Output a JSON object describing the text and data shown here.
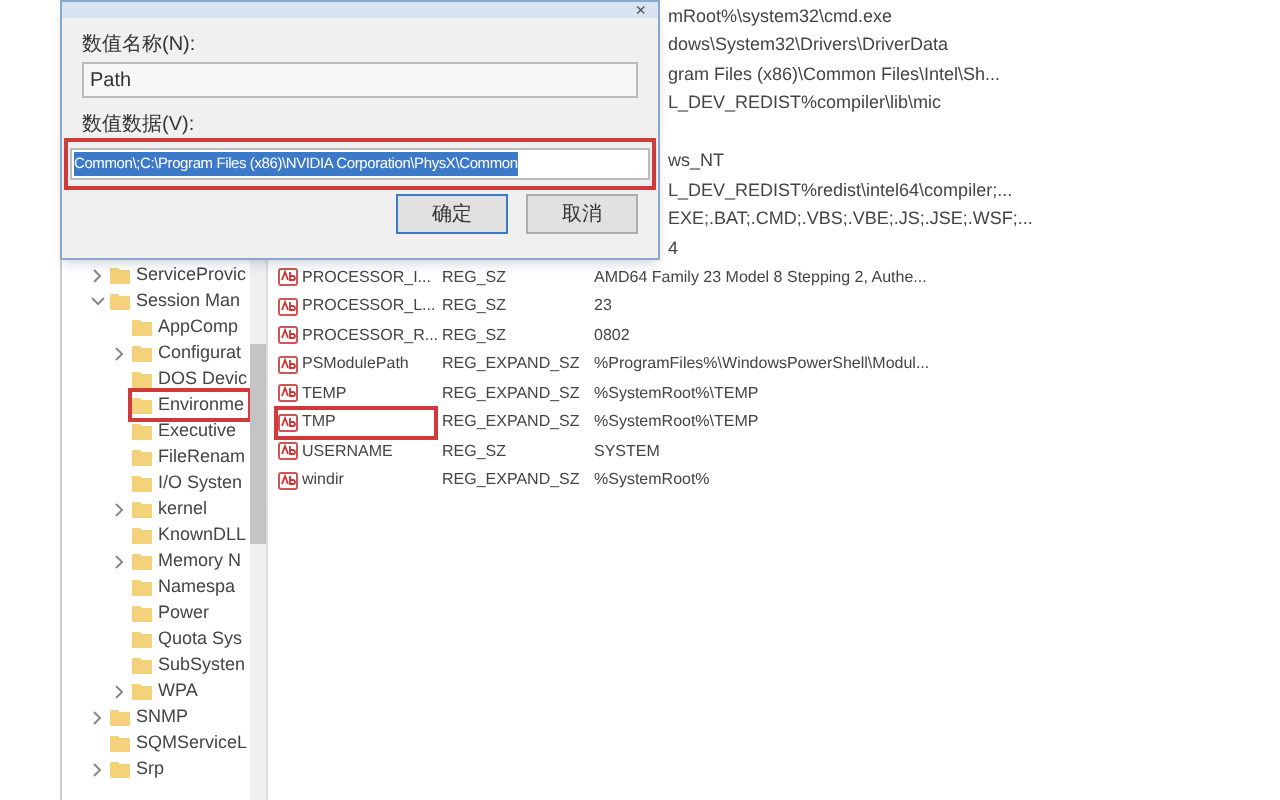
{
  "dialog": {
    "close": "×",
    "name_label": "数值名称(N):",
    "name_value": "Path",
    "data_label": "数值数据(V):",
    "data_value": "Common\\;C:\\Program Files (x86)\\NVIDIA Corporation\\PhysX\\Common",
    "data_highlighted": true,
    "buttons": [
      {
        "label": "确定",
        "default": true
      },
      {
        "label": "取消",
        "default": false
      }
    ]
  },
  "tree": [
    {
      "label": "ServiceProvic",
      "has_children": true,
      "expanded": false,
      "highlighted": false
    },
    {
      "label": "Session Man",
      "has_children": true,
      "expanded": true,
      "highlighted": false,
      "children": [
        {
          "label": "AppComp",
          "has_children": false,
          "expanded": false,
          "highlighted": false
        },
        {
          "label": "Configurat",
          "has_children": true,
          "expanded": false,
          "highlighted": false
        },
        {
          "label": "DOS Devic",
          "has_children": false,
          "expanded": false,
          "highlighted": false
        },
        {
          "label": "Environme",
          "has_children": false,
          "expanded": false,
          "highlighted": true
        },
        {
          "label": "Executive",
          "has_children": false,
          "expanded": false,
          "highlighted": false
        },
        {
          "label": "FileRenam",
          "has_children": false,
          "expanded": false,
          "highlighted": false
        },
        {
          "label": "I/O Systen",
          "has_children": false,
          "expanded": false,
          "highlighted": false
        },
        {
          "label": "kernel",
          "has_children": true,
          "expanded": false,
          "highlighted": false
        },
        {
          "label": "KnownDLL",
          "has_children": false,
          "expanded": false,
          "highlighted": false
        },
        {
          "label": "Memory N",
          "has_children": true,
          "expanded": false,
          "highlighted": false
        },
        {
          "label": "Namespa",
          "has_children": false,
          "expanded": false,
          "highlighted": false
        },
        {
          "label": "Power",
          "has_children": false,
          "expanded": false,
          "highlighted": false
        },
        {
          "label": "Quota Sys",
          "has_children": false,
          "expanded": false,
          "highlighted": false
        },
        {
          "label": "SubSysten",
          "has_children": false,
          "expanded": false,
          "highlighted": false
        },
        {
          "label": "WPA",
          "has_children": true,
          "expanded": false,
          "highlighted": false
        }
      ]
    },
    {
      "label": "SNMP",
      "has_children": true,
      "expanded": false,
      "highlighted": false
    },
    {
      "label": "SQMServiceL",
      "has_children": false,
      "expanded": false,
      "highlighted": false
    },
    {
      "label": "Srp",
      "has_children": true,
      "expanded": false,
      "highlighted": false
    }
  ],
  "hidden_rows": [
    "mRoot%\\system32\\cmd.exe",
    "dows\\System32\\Drivers\\DriverData",
    "gram Files (x86)\\Common Files\\Intel\\Sh...",
    "L_DEV_REDIST%compiler\\lib\\mic",
    null,
    "ws_NT",
    "L_DEV_REDIST%redist\\intel64\\compiler;...",
    "EXE;.BAT;.CMD;.VBS;.VBE;.JS;.JSE;.WSF;...",
    "4"
  ],
  "values": [
    {
      "name": "PROCESSOR_I...",
      "type": "REG_SZ",
      "data": "AMD64 Family 23 Model 8 Stepping 2, Authe...",
      "highlighted": false
    },
    {
      "name": "PROCESSOR_L...",
      "type": "REG_SZ",
      "data": "23",
      "highlighted": false
    },
    {
      "name": "PROCESSOR_R...",
      "type": "REG_SZ",
      "data": "0802",
      "highlighted": false
    },
    {
      "name": "PSModulePath",
      "type": "REG_EXPAND_SZ",
      "data": "%ProgramFiles%\\WindowsPowerShell\\Modul...",
      "highlighted": false
    },
    {
      "name": "TEMP",
      "type": "REG_EXPAND_SZ",
      "data": "%SystemRoot%\\TEMP",
      "highlighted": false
    },
    {
      "name": "TMP",
      "type": "REG_EXPAND_SZ",
      "data": "%SystemRoot%\\TEMP",
      "highlighted": true
    },
    {
      "name": "USERNAME",
      "type": "REG_SZ",
      "data": "SYSTEM",
      "highlighted": false
    },
    {
      "name": "windir",
      "type": "REG_EXPAND_SZ",
      "data": "%SystemRoot%",
      "highlighted": false
    }
  ]
}
